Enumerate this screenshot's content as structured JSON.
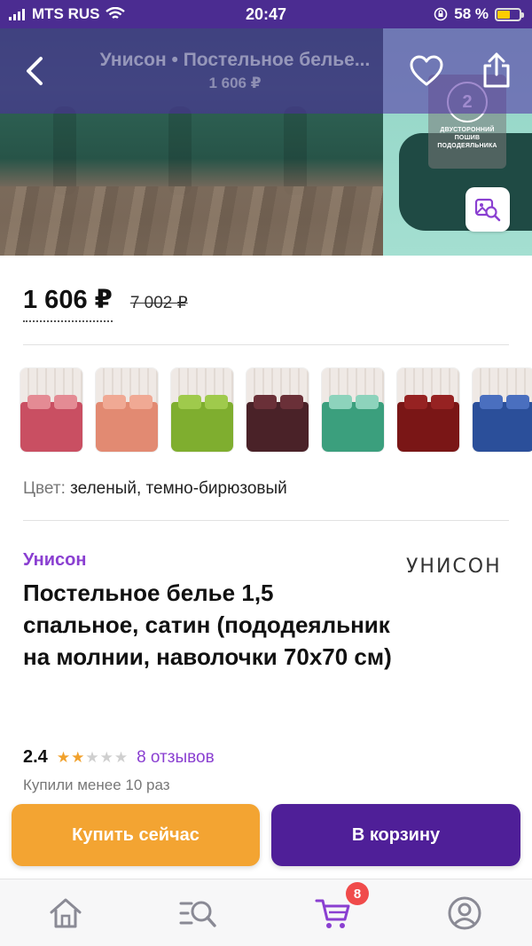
{
  "status_bar": {
    "carrier": "MTS RUS",
    "time": "20:47",
    "battery_percent": "58 %",
    "battery_level": 0.58
  },
  "header": {
    "title": "Унисон • Постельное белье...",
    "subtitle": "1 606 ₽"
  },
  "hero": {
    "badge_digit": "2",
    "badge_text": "ДВУСТОРОННИЙ ПОШИВ ПОДОДЕЯЛЬНИКА"
  },
  "pricing": {
    "price": "1 606 ₽",
    "old_price": "7 002 ₽"
  },
  "variants": [
    {
      "bed": "#c94f62",
      "pillow": "#e48b94",
      "name": "pink"
    },
    {
      "bed": "#e28a72",
      "pillow": "#f0a994",
      "name": "peach"
    },
    {
      "bed": "#7fae2f",
      "pillow": "#9fca4c",
      "name": "green"
    },
    {
      "bed": "#4a2228",
      "pillow": "#6a3038",
      "name": "chocolate"
    },
    {
      "bed": "#3b9f7d",
      "pillow": "#8dd3bc",
      "name": "emerald"
    },
    {
      "bed": "#7a1616",
      "pillow": "#962222",
      "name": "burgundy"
    },
    {
      "bed": "#2b4f9a",
      "pillow": "#4a6fbf",
      "name": "blue"
    }
  ],
  "color": {
    "label": "Цвет:",
    "value": "зеленый, темно-бирюзовый"
  },
  "product": {
    "brand": "Унисон",
    "brand_logo": "УНИСОН",
    "title": "Постельное белье 1,5 спальное, сатин (пододеяльник на молнии, наволочки 70x70 см)",
    "rating": "2.4",
    "rating_value": 2.4,
    "reviews": "8 отзывов",
    "bought": "Купили менее 10 раз"
  },
  "actions": {
    "buy_now": "Купить сейчас",
    "to_cart": "В корзину"
  },
  "tabbar": {
    "cart_count": "8"
  },
  "colors": {
    "accent_purple": "#8a3fd1",
    "cart_button": "#4f1f98",
    "buy_button": "#f3a432",
    "star": "#f1a12c",
    "badge_red": "#f04b4b"
  }
}
